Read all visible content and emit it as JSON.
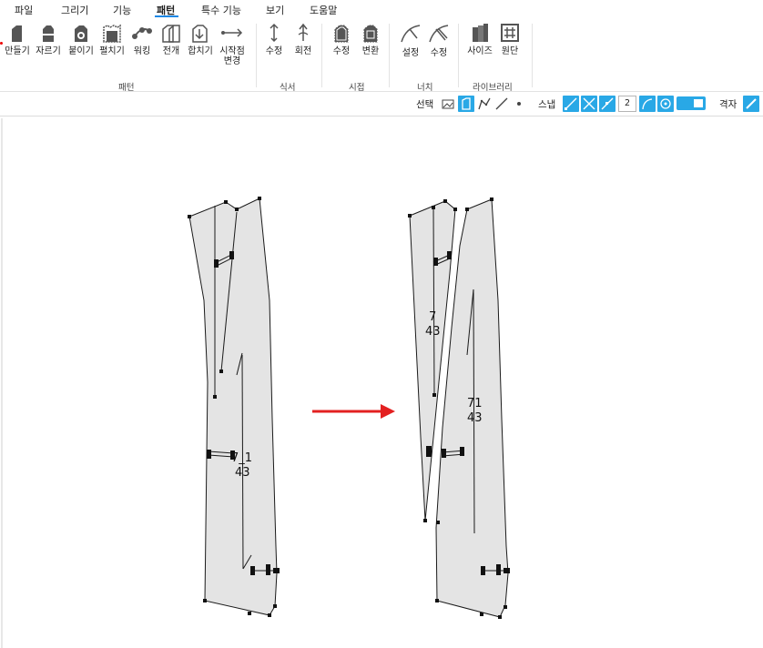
{
  "menu": {
    "items": [
      "파일",
      "그리기",
      "기능",
      "패턴",
      "특수 기능",
      "보기",
      "도움말"
    ],
    "active": "패턴"
  },
  "ribbon": {
    "pattern": {
      "group_label": "패턴",
      "buttons": [
        "만들기",
        "자르기",
        "붙이기",
        "펼치기",
        "워킹",
        "전개",
        "합치기",
        "시작점\n변경"
      ]
    },
    "dart": {
      "group_label": "식서",
      "buttons": [
        "수정",
        "회전"
      ]
    },
    "seam": {
      "group_label": "시접",
      "buttons": [
        "수정",
        "변환"
      ]
    },
    "notch": {
      "group_label": "너치",
      "buttons": [
        "설정",
        "수정"
      ]
    },
    "library": {
      "group_label": "라이브러리",
      "buttons": [
        "사이즈",
        "원단"
      ]
    }
  },
  "toolbar": {
    "select_label": "선택",
    "snap_label": "스냅",
    "snap_value": "2",
    "grid_label": "격자"
  },
  "pieces": {
    "left_label_top": "7_1",
    "left_label_bottom": "43",
    "right_small_label_top": "7",
    "right_small_label_bottom": "43",
    "right_large_label_top": "71",
    "right_large_label_bottom": "43"
  },
  "colors": {
    "accent": "#29a8e6",
    "piece_fill": "#e4e4e4",
    "arrow": "#e32020"
  }
}
